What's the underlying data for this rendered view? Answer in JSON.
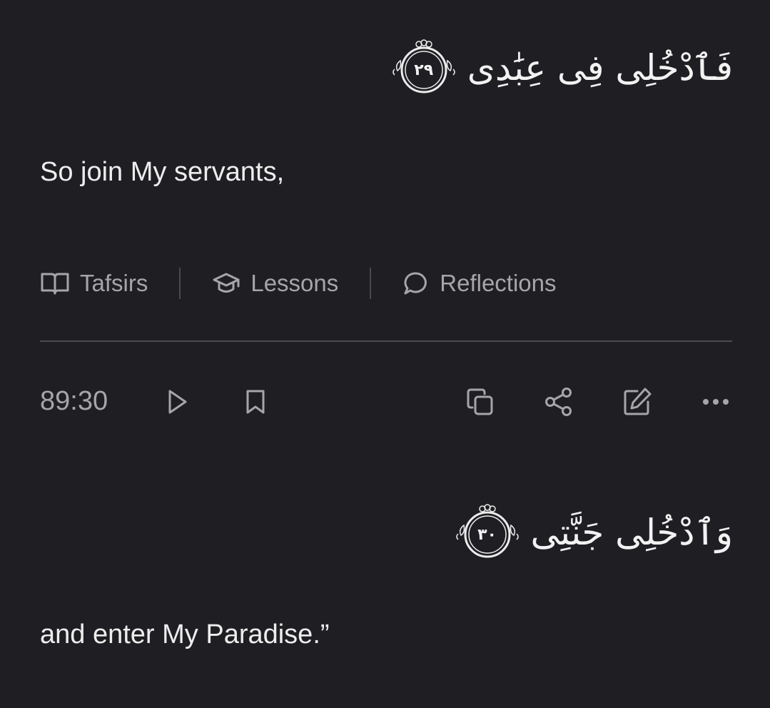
{
  "verses": [
    {
      "arabic": "فَٱدْخُلِى فِى عِبَٰدِى",
      "ayah_number": "٢٩",
      "translation": "So join My servants,"
    },
    {
      "arabic": "وَٱدْخُلِى جَنَّتِى",
      "ayah_number": "٣٠",
      "translation": "and enter My Paradise.”"
    }
  ],
  "resources": {
    "tafsirs_label": "Tafsirs",
    "lessons_label": "Lessons",
    "reflections_label": "Reflections"
  },
  "actions": {
    "verse_key": "89:30",
    "icons": [
      "play-icon",
      "bookmark-icon",
      "copy-icon",
      "share-icon",
      "edit-note-icon",
      "more-icon"
    ]
  },
  "colors": {
    "background": "#1f1f23",
    "primary_text": "#ececec",
    "secondary_text": "#a6a6a8",
    "divider": "#4c4c50"
  }
}
